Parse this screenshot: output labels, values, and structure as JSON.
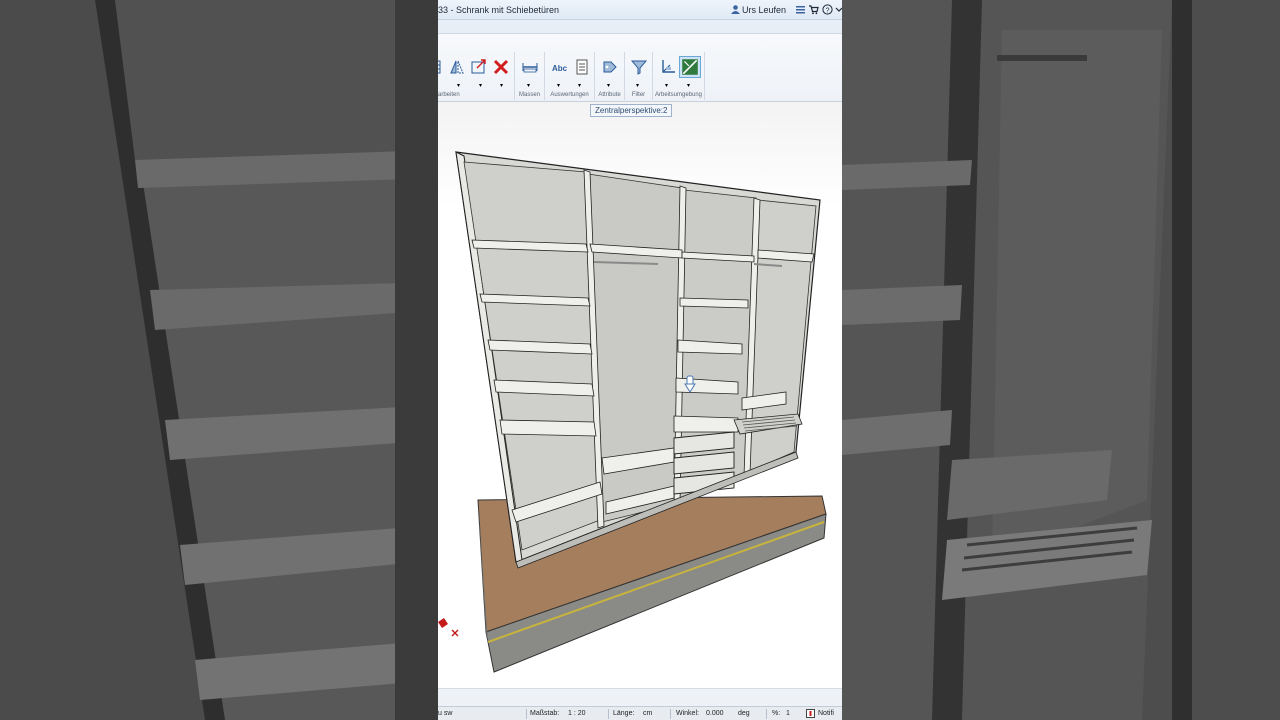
{
  "window": {
    "title": "33 - Schrank mit Schiebetüren",
    "user": "Urs Leufen"
  },
  "ribbon": {
    "groups": [
      {
        "label": "arbeiten"
      },
      {
        "label": "Massen"
      },
      {
        "label": "Auswertungen"
      },
      {
        "label": "Attribute"
      },
      {
        "label": "Filter"
      },
      {
        "label": "Arbeitsumgebung"
      }
    ],
    "measure_abc_label": "Abc"
  },
  "viewport": {
    "tooltip": "Zentralperspektive:2"
  },
  "status": {
    "left_text": "u sw",
    "scale_label": "Maßstab:",
    "scale_value": "1 : 20",
    "length_label": "Länge:",
    "length_value": "cm",
    "angle_label": "Winkel:",
    "angle_value": "0.000",
    "angle_unit": "deg",
    "percent_label": "%:",
    "percent_value": "1",
    "notif": "Notifi"
  },
  "colors": {
    "accent": "#6aa6d6",
    "delete_red": "#d11d1d",
    "floor_wood": "#a57e5e",
    "cabinet": "#dcdcd8"
  }
}
